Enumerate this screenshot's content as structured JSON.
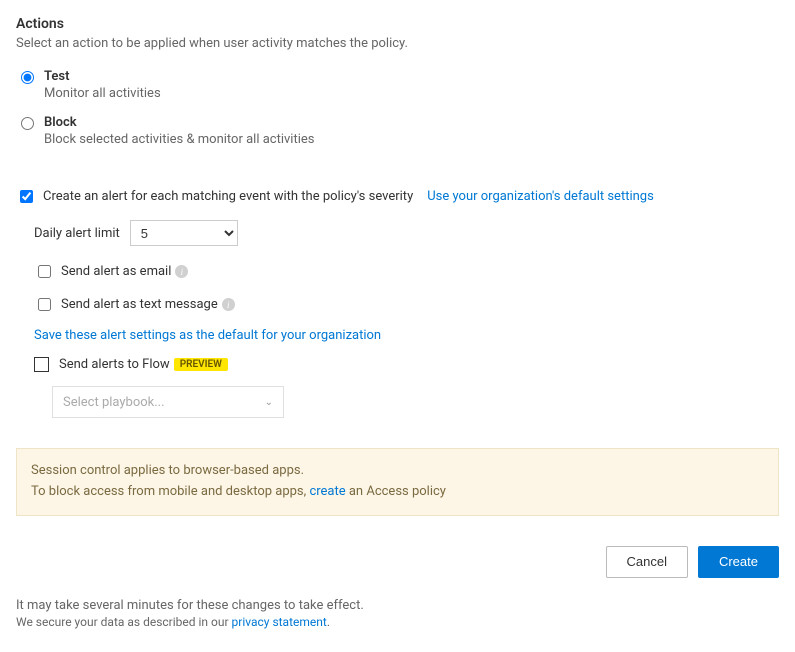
{
  "section": {
    "title": "Actions",
    "desc": "Select an action to be applied when user activity matches the policy."
  },
  "actions": {
    "test": {
      "label": "Test",
      "sub": "Monitor all activities"
    },
    "block": {
      "label": "Block",
      "sub": "Block selected activities & monitor all activities"
    }
  },
  "alerts": {
    "create_label": "Create an alert for each matching event with the policy's severity",
    "default_link": "Use your organization's default settings",
    "daily_limit_label": "Daily alert limit",
    "daily_limit_value": "5",
    "send_email_label": "Send alert as email",
    "send_text_label": "Send alert as text message",
    "save_defaults_link": "Save these alert settings as the default for your organization",
    "send_flow_label": "Send alerts to Flow",
    "preview_badge": "PREVIEW",
    "playbook_placeholder": "Select playbook..."
  },
  "banner": {
    "line1": "Session control applies to browser-based apps.",
    "line2_pre": "To block access from mobile and desktop apps, ",
    "line2_link": "create",
    "line2_post": " an Access policy"
  },
  "buttons": {
    "cancel": "Cancel",
    "create": "Create"
  },
  "footer": {
    "note": "It may take several minutes for these changes to take effect.",
    "privacy_pre": "We secure your data as described in our ",
    "privacy_link": "privacy statement",
    "privacy_post": "."
  }
}
